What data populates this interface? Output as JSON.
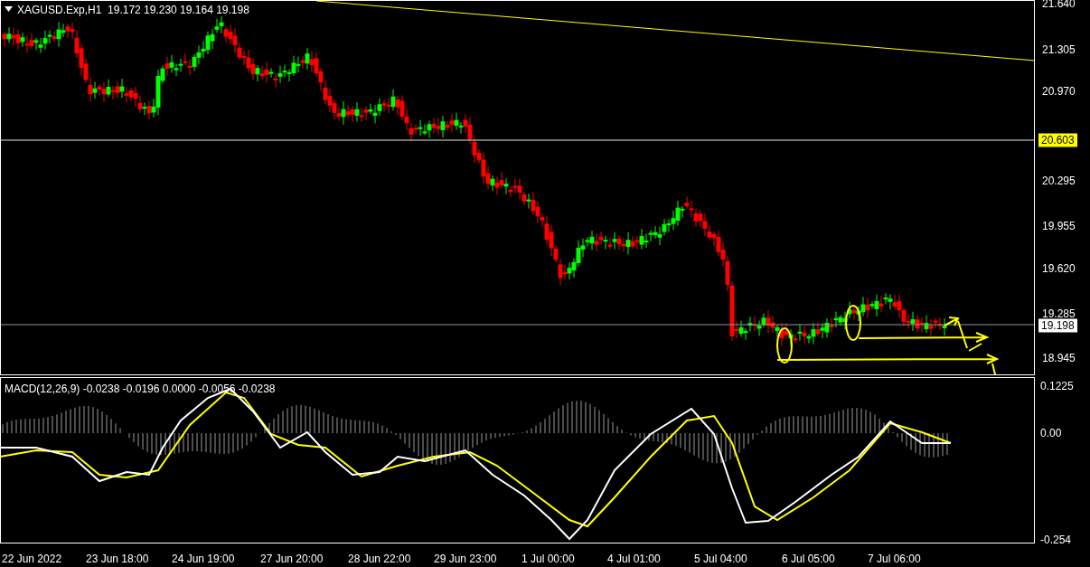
{
  "main_panel": {
    "header": "XAGUSD.Exp,H1  19.172 19.230 19.164 19.198",
    "price_ticks": [
      "21.640",
      "21.305",
      "20.970",
      "20.295",
      "19.955",
      "19.620",
      "19.285",
      "18.945"
    ],
    "price_labels": [
      {
        "text": "20.603",
        "color": "#ffff00"
      },
      {
        "text": "19.198",
        "color": "#ffffff"
      }
    ]
  },
  "macd_panel": {
    "header": "MACD(12,26,9) -0.0238 -0.0196 0.0000 -0.0056 -0.0238",
    "ticks": [
      "0.1225",
      "0.00",
      "-0.254"
    ]
  },
  "time_axis": [
    "22 Jun 2022",
    "23 Jun 18:00",
    "24 Jun 19:00",
    "27 Jun 20:00",
    "28 Jun 22:00",
    "29 Jun 23:00",
    "1 Jul 00:00",
    "4 Jul 01:00",
    "5 Jul 04:00",
    "6 Jul 05:00",
    "7 Jul 06:00"
  ]
}
